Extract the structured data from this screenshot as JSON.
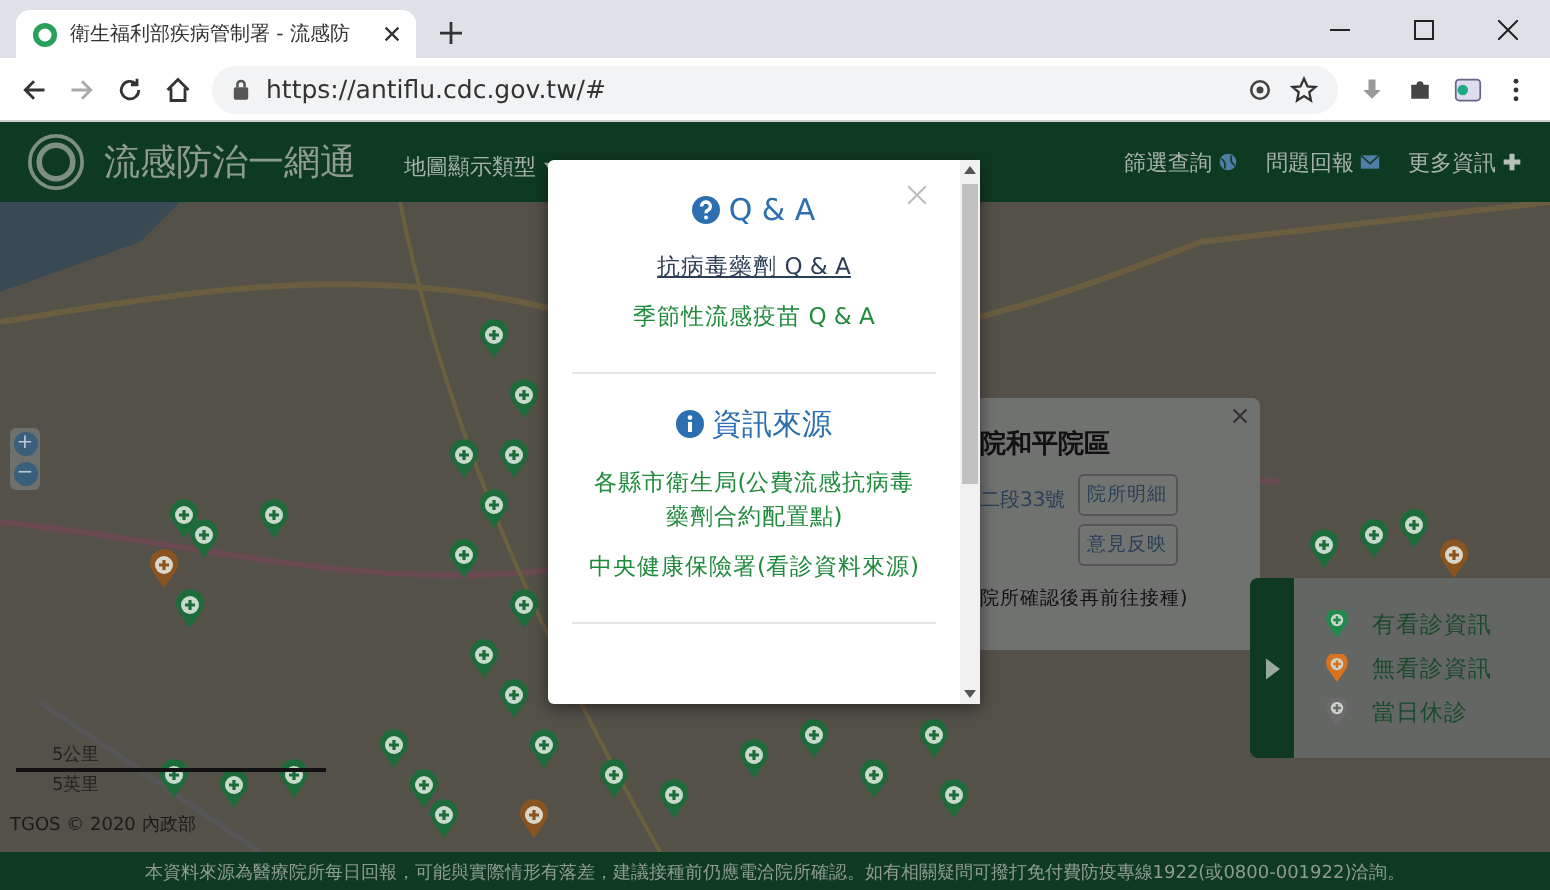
{
  "browser": {
    "tab_title": "衛生福利部疾病管制署 - 流感防",
    "address": "https://antiflu.cdc.gov.tw/#"
  },
  "navbar": {
    "site_title": "流感防治一網通",
    "menu": [
      {
        "label": "地圖顯示類型",
        "dropdown": true
      }
    ],
    "links": [
      {
        "label": "篩選查詢"
      },
      {
        "label": "問題回報"
      },
      {
        "label": "更多資訊"
      }
    ]
  },
  "map": {
    "zoom_controls": [
      "+",
      "−"
    ],
    "scale": [
      "5公里",
      "5英里"
    ],
    "attribution": "TGOS © 2020 內政部",
    "popup": {
      "title": "院和平院區",
      "address": "二段33號",
      "note": "院所確認後再前往接種)",
      "buttons": [
        "院所明細",
        "意見反映"
      ]
    },
    "legend": [
      {
        "label": "有看診資訊",
        "color": "#1f8a4c"
      },
      {
        "label": "無看診資訊",
        "color": "#d9731f"
      },
      {
        "label": "當日休診",
        "color": "#6b6b6b"
      }
    ]
  },
  "modal": {
    "sections": [
      {
        "title": "Q & A",
        "links": [
          {
            "label": "抗病毒藥劑 Q & A",
            "hovered": true
          },
          {
            "label": "季節性流感疫苗 Q & A",
            "hovered": false
          }
        ]
      },
      {
        "title": "資訊來源",
        "links": [
          {
            "label": "各縣市衛生局(公費流感抗病毒藥劑合約配置點)",
            "hovered": false
          },
          {
            "label": "中央健康保險署(看診資料來源)",
            "hovered": false
          }
        ]
      }
    ]
  },
  "footer": {
    "text": "本資料來源為醫療院所每日回報，可能與實際情形有落差，建議接種前仍應電洽院所確認。如有相關疑問可撥打免付費防疫專線1922(或0800-001922)洽詢。"
  }
}
